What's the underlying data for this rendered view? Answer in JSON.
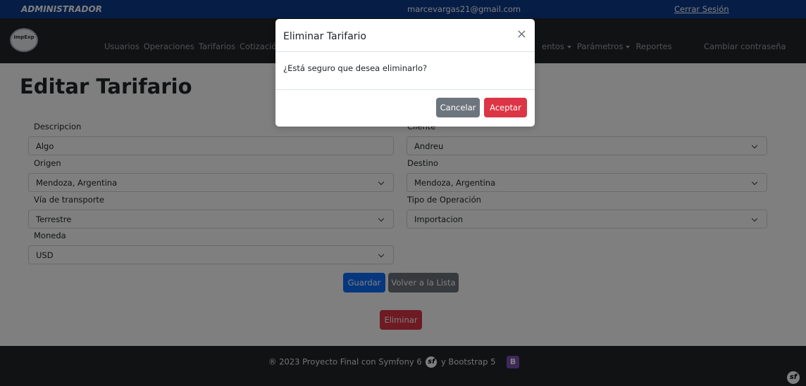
{
  "topbar": {
    "role": "ADMINISTRADOR",
    "email": "marcevargas21@gmail.com",
    "logout_label": "Cerrar Sesión"
  },
  "navbar": {
    "logo_text": "ImpExp",
    "links": [
      "Usuarios",
      "Operaciones",
      "Tarifarios",
      "Cotización"
    ],
    "links_right": [
      {
        "label": "entos",
        "dropdown": true
      },
      {
        "label": "Parámetros",
        "dropdown": true
      },
      {
        "label": "Reportes",
        "dropdown": false
      }
    ],
    "change_password": "Cambiar contraseña"
  },
  "page": {
    "title": "Editar Tarifario"
  },
  "form": {
    "descripcion": {
      "label": "Descripcion",
      "value": "Algo"
    },
    "cliente": {
      "label": "Cliente",
      "value": "Andreu"
    },
    "origen": {
      "label": "Origen",
      "value": "Mendoza, Argentina"
    },
    "destino": {
      "label": "Destino",
      "value": "Mendoza, Argentina"
    },
    "via": {
      "label": "Vía de transporte",
      "value": "Terrestre"
    },
    "tipo": {
      "label": "Tipo de Operación",
      "value": "Importacion"
    },
    "moneda": {
      "label": "Moneda",
      "value": "USD"
    }
  },
  "buttons": {
    "save": "Guardar",
    "back": "Volver a la Lista",
    "delete": "Eliminar"
  },
  "footer": {
    "text_before": "® 2023 Proyecto Final con Symfony 6",
    "text_after": "y Bootstrap 5",
    "symfony_glyph": "sf",
    "bootstrap_glyph": "B"
  },
  "modal": {
    "title": "Eliminar Tarifario",
    "close_glyph": "×",
    "body": "¿Está seguro que desea eliminarlo?",
    "cancel": "Cancelar",
    "accept": "Aceptar"
  }
}
